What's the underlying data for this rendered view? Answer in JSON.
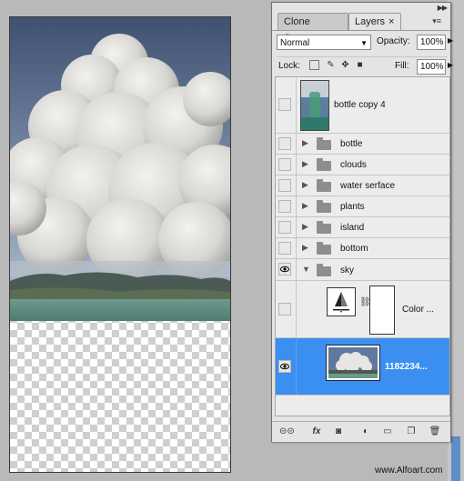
{
  "panel": {
    "tabs": [
      {
        "label": "Clone Source"
      },
      {
        "label": "Layers",
        "close": "×"
      }
    ],
    "blend_mode": "Normal",
    "opacity_label": "Opacity:",
    "opacity_value": "100%",
    "lock_label": "Lock:",
    "fill_label": "Fill:",
    "fill_value": "100%",
    "layers": [
      {
        "name": "bottle copy 4",
        "type": "layer",
        "visible": false
      },
      {
        "name": "bottle",
        "type": "group",
        "visible": false,
        "expanded": false
      },
      {
        "name": "clouds",
        "type": "group",
        "visible": false,
        "expanded": false
      },
      {
        "name": "water serface",
        "type": "group",
        "visible": false,
        "expanded": false
      },
      {
        "name": "plants",
        "type": "group",
        "visible": false,
        "expanded": false
      },
      {
        "name": "island",
        "type": "group",
        "visible": false,
        "expanded": false
      },
      {
        "name": "bottom",
        "type": "group",
        "visible": false,
        "expanded": false
      },
      {
        "name": "sky",
        "type": "group",
        "visible": true,
        "expanded": true
      },
      {
        "name": "Color ...",
        "type": "adjustment",
        "visible": false
      },
      {
        "name": "1182234...",
        "type": "layer",
        "visible": true,
        "selected": true
      }
    ],
    "bottom_icons": [
      "link-icon",
      "fx-icon",
      "mask-icon",
      "adjustment-icon",
      "folder-icon",
      "new-layer-icon",
      "trash-icon"
    ],
    "fx_label": "fx"
  },
  "watermark": "www.Alfoart.com",
  "colors": {
    "selection": "#3b8ff0",
    "panel_bg": "#e4e4e4"
  }
}
